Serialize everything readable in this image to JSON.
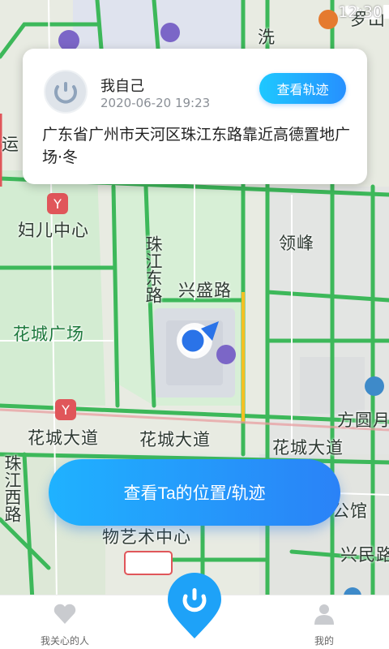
{
  "status_bar": {
    "time": "12:30"
  },
  "card": {
    "name": "我自己",
    "time": "2020-06-20 19:23",
    "track_button": "查看轨迹",
    "address": "广东省广州市天河区珠江东路靠近高德置地广场·冬"
  },
  "map_labels": {
    "top_right": "罗山",
    "top_road": "洗",
    "left_road": "运",
    "fuer": "妇儿中心",
    "lingfeng": "领峰",
    "zhujiang_east": "珠江东路",
    "xingsheng": "兴盛路",
    "huacheng_square": "花城广场",
    "fangyuan": "方圆月",
    "huacheng_ave_left": "花城大道",
    "huacheng_ave_mid": "花城大道",
    "huacheng_ave_right": "花城大道",
    "zhujiang_west": "珠江西路",
    "gongguan": "公馆",
    "art_center": "物艺术中心",
    "xingmin": "兴民路"
  },
  "main_button": "查看Ta的位置/轨迹",
  "nav": {
    "left_label": "我关心的人",
    "right_label": "我的"
  },
  "colors": {
    "accent": "#2690ff",
    "road_green": "#3db85a",
    "road_red": "#e0565a",
    "map_base": "#e9ece4"
  }
}
